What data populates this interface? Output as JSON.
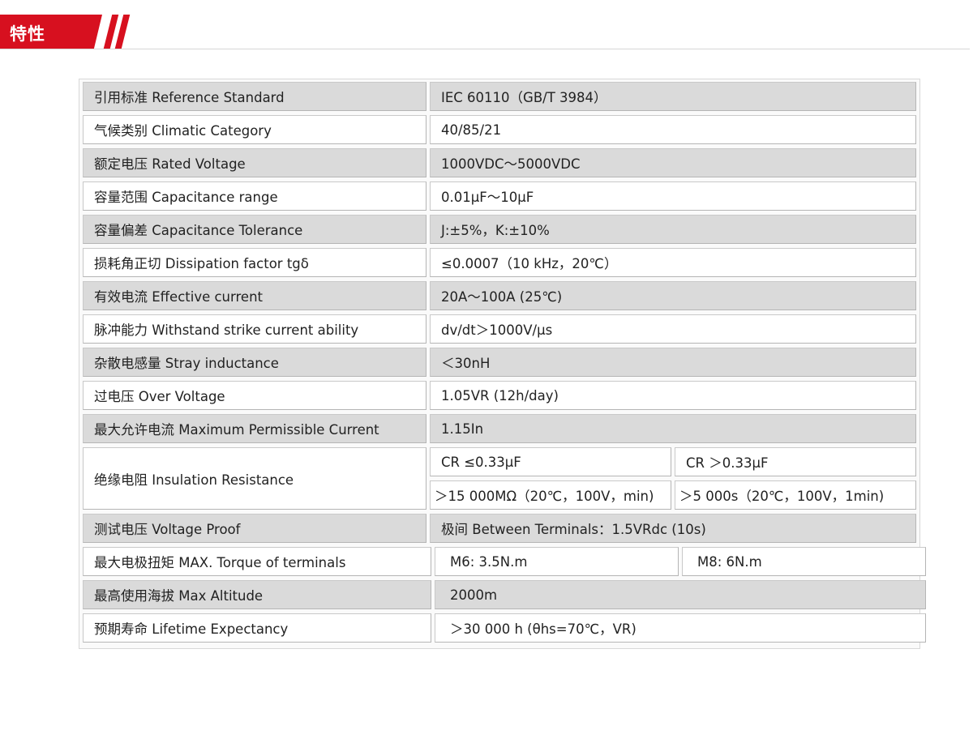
{
  "header": {
    "title": "特性"
  },
  "spec_rows": [
    {
      "label": "引用标准  Reference Standard",
      "value": "IEC 60110（GB/T 3984）"
    },
    {
      "label": "气候类别  Climatic Category",
      "value": "40/85/21"
    },
    {
      "label": "额定电压  Rated Voltage",
      "value": "1000VDC～5000VDC"
    },
    {
      "label": "容量范围  Capacitance range",
      "value": "0.01μF～10μF"
    },
    {
      "label": "容量偏差  Capacitance Tolerance",
      "value": "J:±5%，K:±10%"
    },
    {
      "label": "损耗角正切  Dissipation factor tgδ",
      "value": "≤0.0007（10 kHz，20℃）"
    },
    {
      "label": "有效电流   Effective current",
      "value": "20A～100A (25℃)"
    },
    {
      "label": "脉冲能力   Withstand strike current ability",
      "value": "dv/dt＞1000V/μs"
    },
    {
      "label": "杂散电感量  Stray inductance",
      "value": "＜30nH"
    },
    {
      "label": "过电压 Over Voltage",
      "value": "1.05VR   (12h/day)"
    },
    {
      "label": "最大允许电流 Maximum Permissible Current",
      "value": "1.15In"
    }
  ],
  "insulation": {
    "label": "绝缘电阻  Insulation Resistance",
    "cr_low": "CR ≤0.33μF",
    "cr_high": "CR ＞0.33μF",
    "val_low": "＞15 000MΩ（20℃，100V，min)",
    "val_high": "＞5 000s（20℃，100V，1min)"
  },
  "voltage_proof": {
    "label": "测试电压   Voltage Proof",
    "value": "极间 Between Terminals：1.5VRdc (10s)"
  },
  "torque": {
    "label": "最大电极扭矩  MAX. Torque of terminals",
    "m6": "M6: 3.5N.m",
    "m8": "M8: 6N.m"
  },
  "altitude": {
    "label": "最高使用海拔  Max Altitude",
    "value": "2000m"
  },
  "lifetime": {
    "label": "预期寿命   Lifetime Expectancy",
    "value": "＞30 000 h  (θhs=70℃，VR)"
  },
  "colors": {
    "brand_red": "#d7101f",
    "row_grey": "#dadada",
    "row_white": "#ffffff"
  }
}
